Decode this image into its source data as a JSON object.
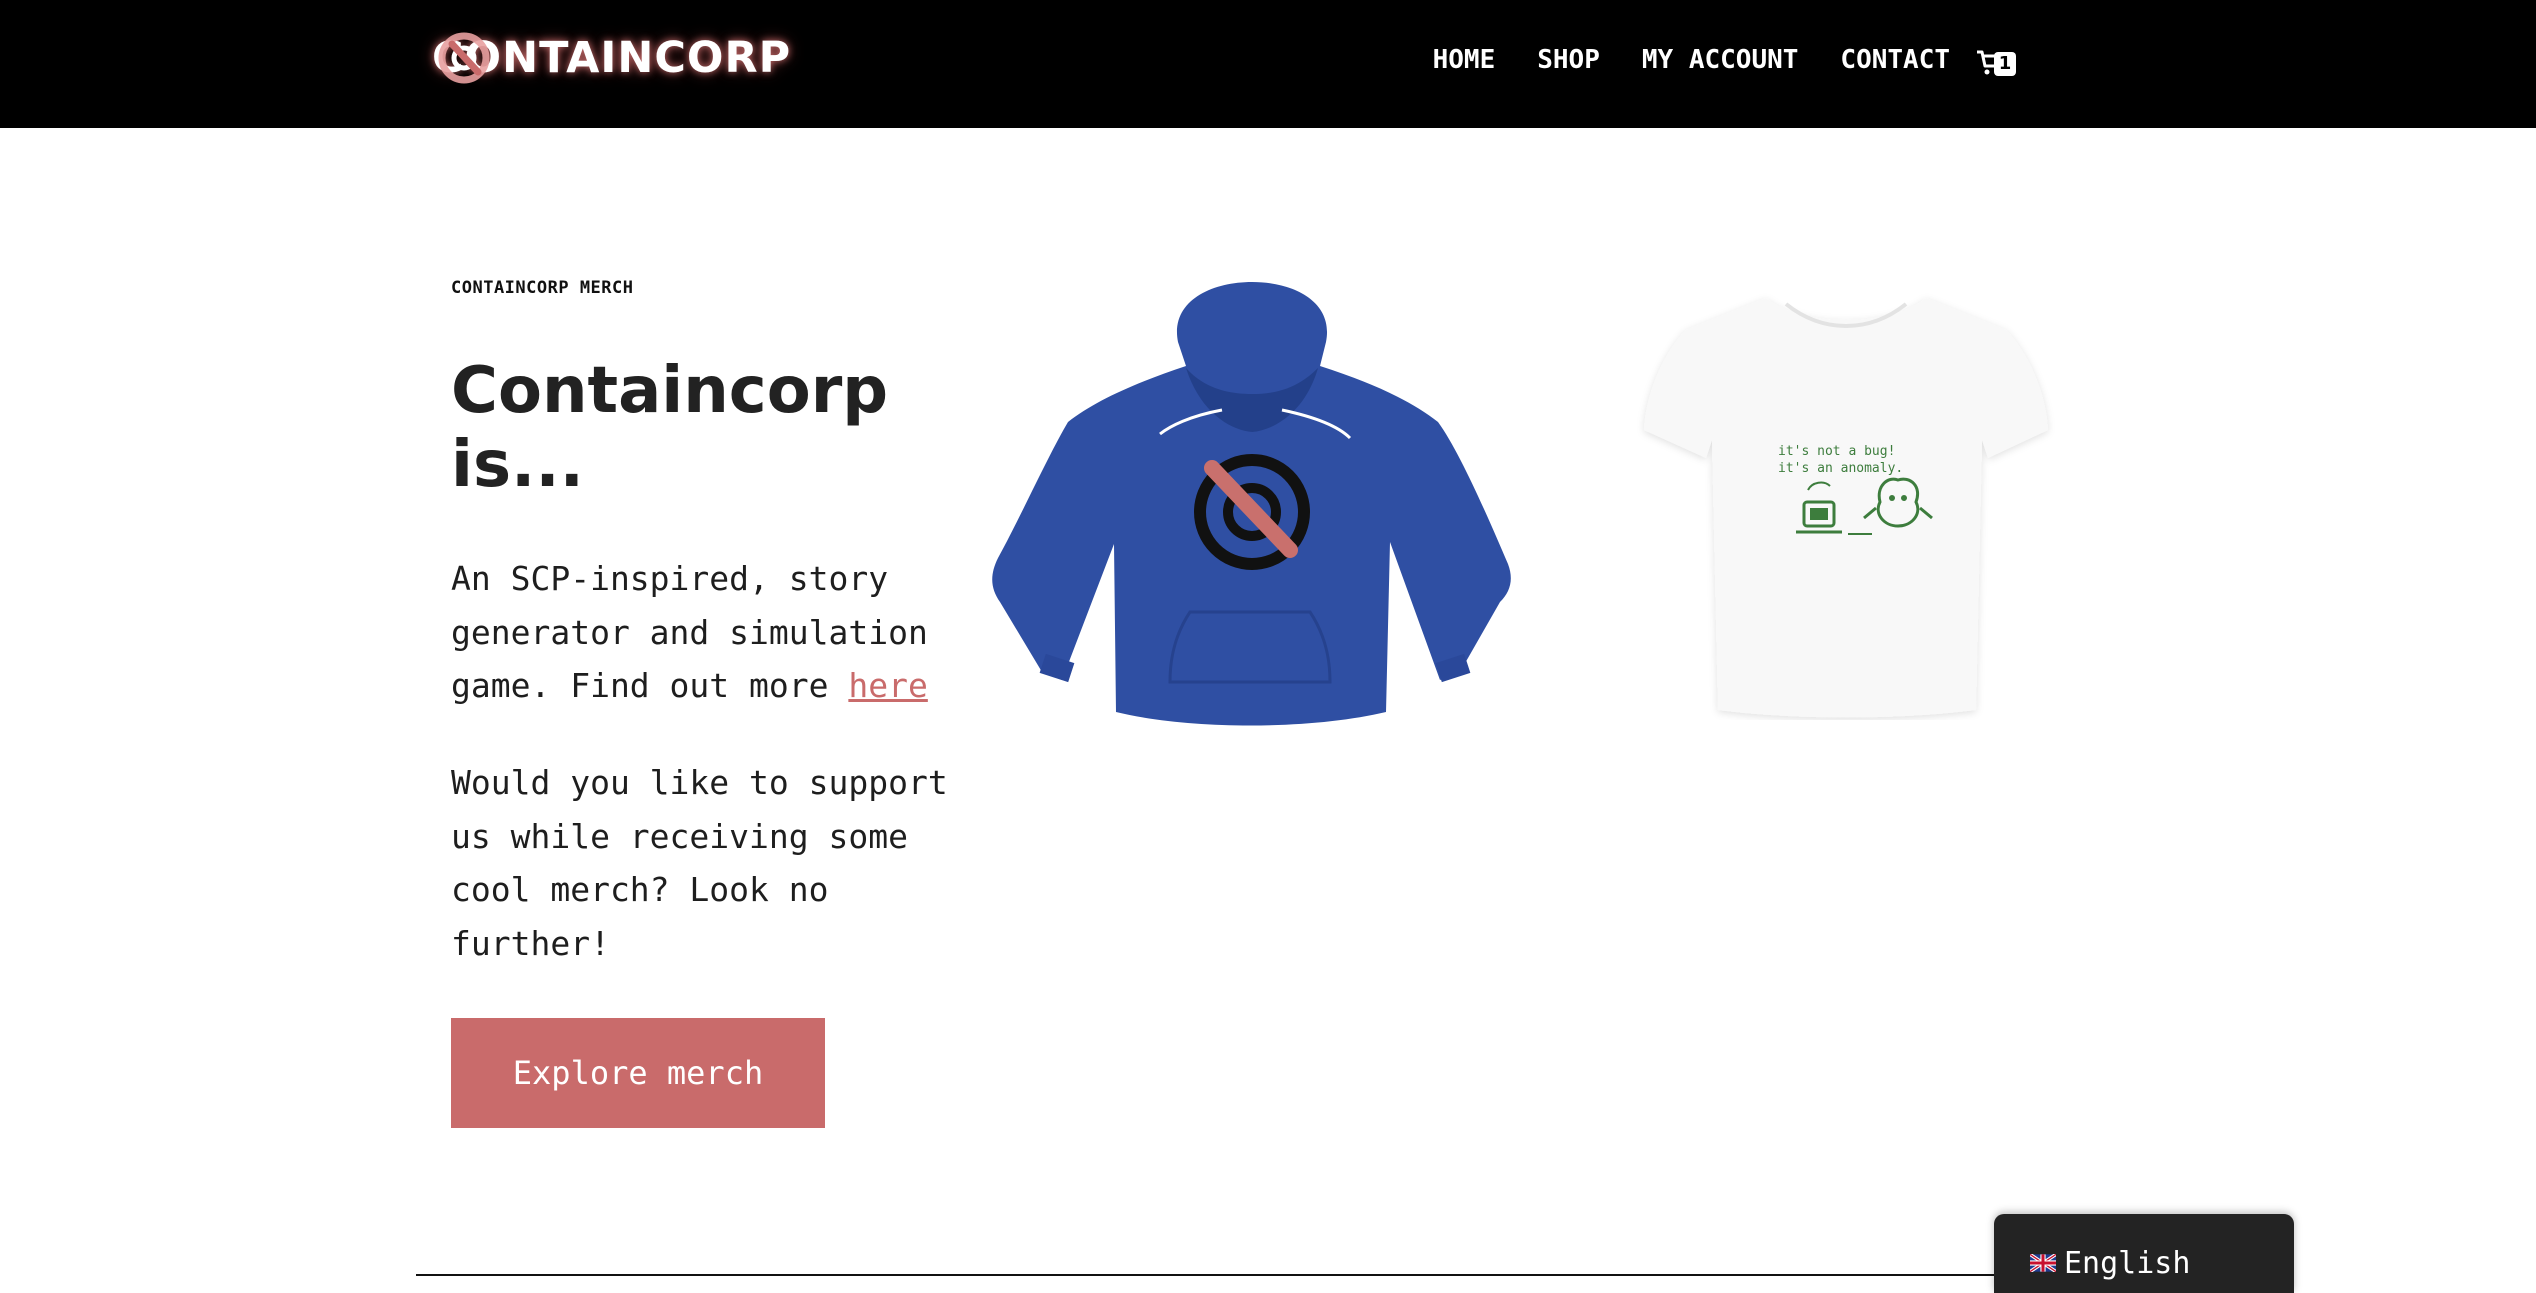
{
  "header": {
    "logo_text": "CONTAINCORP",
    "nav": [
      {
        "label": "HOME"
      },
      {
        "label": "SHOP"
      },
      {
        "label": "MY ACCOUNT"
      },
      {
        "label": "CONTACT"
      }
    ],
    "cart_count": "1",
    "cart_icon": "cart-icon"
  },
  "hero": {
    "eyebrow": "CONTAINCORP MERCH",
    "title": "Containcorp is...",
    "desc_prefix": "An SCP-inspired, story generator and simulation game. Find out more ",
    "desc_link": "here",
    "support": "Would you like to support us while receiving some cool merch? Look no further!",
    "cta_label": "Explore merch"
  },
  "products": [
    {
      "name": "hoodie",
      "color": "#2f4fa3"
    },
    {
      "name": "tshirt",
      "print_line1": "it's not a bug!",
      "print_line2": "it's an anomaly."
    }
  ],
  "language": {
    "label": "English",
    "flag": "uk-flag-icon"
  },
  "colors": {
    "accent": "#c96b6b",
    "header_bg": "#000000",
    "hoodie": "#2f4fa3",
    "print_green": "#3d7d3d"
  }
}
